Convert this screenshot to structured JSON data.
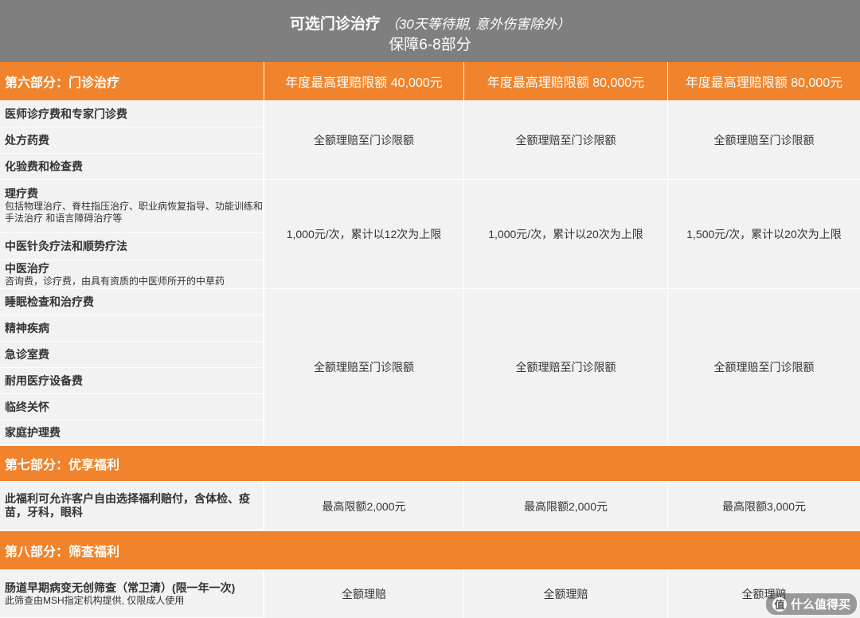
{
  "header": {
    "title": "可选门诊治疗",
    "note": "（30天等待期, 意外伤害除外）",
    "subtitle": "保障6-8部分"
  },
  "section6": {
    "label": "第六部分：门诊治疗",
    "col1": "年度最高理赔限额 40,000元",
    "col2": "年度最高理赔限额 80,000元",
    "col3": "年度最高理赔限额 80,000元"
  },
  "rows": [
    {
      "title": "医师诊疗费和专家门诊费",
      "sub": ""
    },
    {
      "title": "处方药费",
      "sub": ""
    },
    {
      "title": "化验费和检查费",
      "sub": ""
    },
    {
      "title": "理疗费",
      "sub": "包括物理治疗、脊柱指压治疗、职业病恢复指导、功能训练和手法治疗 和语言障碍治疗等"
    },
    {
      "title": "中医针灸疗法和顺势疗法",
      "sub": ""
    },
    {
      "title": "中医治疗",
      "sub": "咨询费，诊疗费，由具有资质的中医师所开的中草药"
    },
    {
      "title": "睡眠检查和治疗费",
      "sub": ""
    },
    {
      "title": "精神疾病",
      "sub": ""
    },
    {
      "title": "急诊室费",
      "sub": ""
    },
    {
      "title": "耐用医疗设备费",
      "sub": ""
    },
    {
      "title": "临终关怀",
      "sub": ""
    },
    {
      "title": "家庭护理费",
      "sub": ""
    }
  ],
  "group1": {
    "c1": "全额理赔至门诊限额",
    "c2": "全额理赔至门诊限额",
    "c3": "全额理赔至门诊限额"
  },
  "group2": {
    "c1": "1,000元/次，累计以12次为上限",
    "c2": "1,000元/次，累计以20次为上限",
    "c3": "1,500元/次，累计以20次为上限"
  },
  "group3": {
    "c1": "全额理赔至门诊限额",
    "c2": "全额理赔至门诊限额",
    "c3": "全额理赔至门诊限额"
  },
  "section7": {
    "label": "第七部分：优享福利",
    "row_title": "此福利可允许客户自由选择福利赔付，含体检、疫苗，牙科，眼科",
    "c1": "最高限额2,000元",
    "c2": "最高限额2,000元",
    "c3": "最高限额3,000元"
  },
  "section8": {
    "label": "第八部分：筛查福利",
    "row_title": "肠道早期病变无创筛查（常卫清）(限一年一次)",
    "row_sub": "此筛查由MSH指定机构提供, 仅限成人使用",
    "c1": "全额理赔",
    "c2": "全额理赔",
    "c3": "全额理赔"
  },
  "watermark": {
    "text": "什么值得买",
    "icon": "值"
  }
}
